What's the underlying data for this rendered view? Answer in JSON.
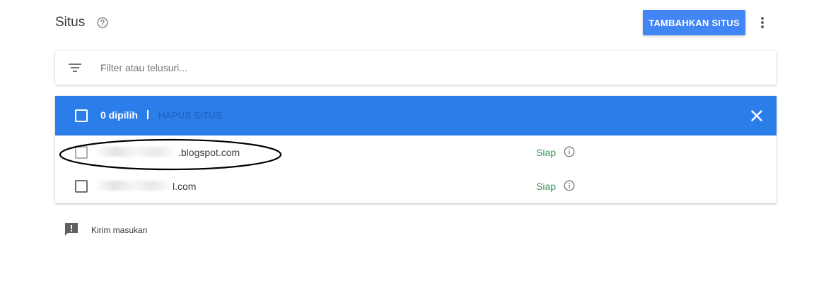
{
  "header": {
    "title": "Situs",
    "help_icon": "help-circle-icon",
    "add_button_label": "TAMBAHKAN SITUS",
    "more_icon": "more-vert-icon"
  },
  "filter": {
    "icon": "filter-list-icon",
    "placeholder": "Filter atau telusuri...",
    "value": ""
  },
  "selection_bar": {
    "selected_count_label": "0 dipilih",
    "separator": "|",
    "delete_label": "HAPUS SITUS",
    "close_icon": "close-icon",
    "background_color": "#2b7de9"
  },
  "sites": [
    {
      "name": ".blogspot.com",
      "status": "Siap",
      "status_icon": "info-outline-icon",
      "checked": false
    },
    {
      "name": "l.com",
      "status": "Siap",
      "status_icon": "info-outline-icon",
      "checked": false
    }
  ],
  "feedback": {
    "icon": "feedback-icon",
    "label": "Kirim masukan"
  },
  "colors": {
    "accent": "#4285f4",
    "status_ready": "#3c9a5a"
  }
}
